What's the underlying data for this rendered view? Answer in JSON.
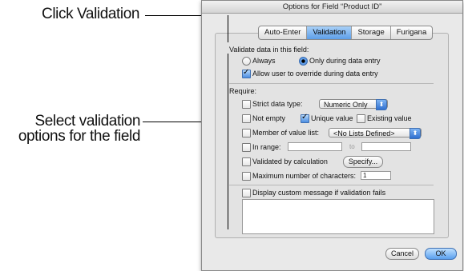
{
  "callouts": {
    "click_validation": "Click Validation",
    "select_options_line1": "Select validation",
    "select_options_line2": "options for the field"
  },
  "dialog": {
    "title": "Options for Field “Product ID”",
    "tabs": [
      {
        "label": "Auto-Enter",
        "active": false
      },
      {
        "label": "Validation",
        "active": true
      },
      {
        "label": "Storage",
        "active": false
      },
      {
        "label": "Furigana",
        "active": false
      }
    ],
    "validate_heading": "Validate data in this field:",
    "validate_always": "Always",
    "validate_only_during_entry": "Only during data entry",
    "validate_selected": "Only during data entry",
    "allow_override": {
      "label": "Allow user to override during data entry",
      "checked": true
    },
    "require_heading": "Require:",
    "strict_type": {
      "label": "Strict data type:",
      "checked": false,
      "value": "Numeric Only"
    },
    "not_empty": {
      "label": "Not empty",
      "checked": false
    },
    "unique_value": {
      "label": "Unique value",
      "checked": true
    },
    "existing_value": {
      "label": "Existing value",
      "checked": false
    },
    "member_of_list": {
      "label": "Member of value list:",
      "checked": false,
      "value": "<No Lists Defined>"
    },
    "in_range": {
      "label": "In range:",
      "checked": false,
      "from": "",
      "to_label": "to",
      "to": ""
    },
    "validated_by_calc": {
      "label": "Validated by calculation",
      "checked": false,
      "button": "Specify..."
    },
    "max_chars": {
      "label": "Maximum number of characters:",
      "checked": false,
      "value": "1"
    },
    "custom_message": {
      "label": "Display custom message if validation fails",
      "checked": false,
      "text": ""
    },
    "cancel_button": "Cancel",
    "ok_button": "OK"
  },
  "colors": {
    "accent": "#4b8ee0",
    "dialog_bg": "#e9e9e9"
  }
}
